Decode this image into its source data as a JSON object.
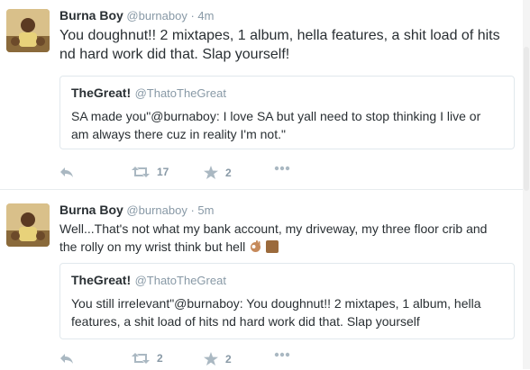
{
  "tweets": [
    {
      "name": "Burna Boy",
      "handle": "@burnaboy",
      "separator": "·",
      "time": "4m",
      "text_line1": "You doughnut!! 2 mixtapes, 1 album, hella features, a shit load of hits",
      "text_line2": "nd hard work did that. Slap yourself!",
      "quote": {
        "name": "TheGreat!",
        "handle": "@ThatoTheGreat",
        "text_line1": "SA made you\"@burnaboy: I love SA but yall need to stop thinking I live or",
        "text_line2": "am always there cuz in reality I'm not.\""
      },
      "retweets": "17",
      "favorites": "2",
      "icons": [
        "reply-icon",
        "retweet-icon",
        "favorite-star-icon",
        "more-dots-icon"
      ]
    },
    {
      "name": "Burna Boy",
      "handle": "@burnaboy",
      "separator": "·",
      "time": "5m",
      "text_line1": "Well...That's not what my bank account, my driveway, my three floor crib and",
      "text_line2": "the rolly on my wrist think but hell",
      "quote": {
        "name": "TheGreat!",
        "handle": "@ThatoTheGreat",
        "text_line1": "You still irrelevant\"@burnaboy: You doughnut!! 2 mixtapes, 1 album, hella",
        "text_line2": "features, a shit load of hits nd hard work did that. Slap yourself"
      },
      "retweets": "2",
      "favorites": "2",
      "icons": [
        "reply-icon",
        "retweet-icon",
        "favorite-star-icon",
        "more-dots-icon"
      ]
    }
  ],
  "colors": {
    "text": "#292f33",
    "muted": "#8899a6",
    "border": "#e1e8ed",
    "icon": "#aab8c2"
  }
}
